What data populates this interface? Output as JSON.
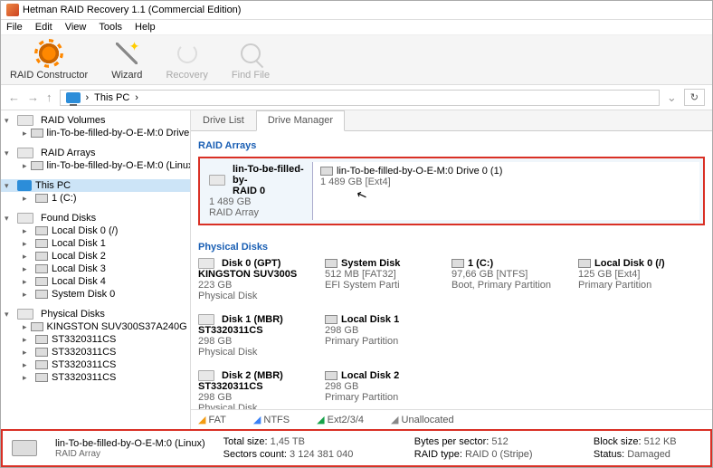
{
  "window": {
    "title": "Hetman RAID Recovery 1.1 (Commercial Edition)"
  },
  "menu": {
    "file": "File",
    "edit": "Edit",
    "view": "View",
    "tools": "Tools",
    "help": "Help"
  },
  "toolbar": {
    "raid_constructor": "RAID Constructor",
    "wizard": "Wizard",
    "recovery": "Recovery",
    "find_file": "Find File"
  },
  "nav": {
    "path": "This PC",
    "sep": "›"
  },
  "tree": {
    "raid_volumes": "RAID Volumes",
    "raid_vol_item": "lin-To-be-filled-by-O-E-M:0 Drive 0",
    "raid_arrays": "RAID Arrays",
    "raid_arr_item": "lin-To-be-filled-by-O-E-M:0 (Linux)",
    "this_pc": "This PC",
    "c_drive": "1 (C:)",
    "found_disks": "Found Disks",
    "local_disk_0": "Local Disk 0 (/)",
    "local_disk_1": "Local Disk 1",
    "local_disk_2": "Local Disk 2",
    "local_disk_3": "Local Disk 3",
    "local_disk_4": "Local Disk 4",
    "system_disk_0": "System Disk 0",
    "physical_disks": "Physical Disks",
    "kingston": "KINGSTON SUV300S37A240G",
    "st1": "ST3320311CS",
    "st2": "ST3320311CS",
    "st3": "ST3320311CS",
    "st4": "ST3320311CS"
  },
  "tabs": {
    "drive_list": "Drive List",
    "drive_manager": "Drive Manager"
  },
  "sections": {
    "raid_arrays": "RAID Arrays",
    "physical_disks": "Physical Disks"
  },
  "raid_box": {
    "left_name": "lin-To-be-filled-by-",
    "left_type": "RAID 0",
    "left_size": "1 489 GB",
    "left_kind": "RAID Array",
    "right_name": "lin-To-be-filled-by-O-E-M:0 Drive 0 (1)",
    "right_size": "1 489 GB [Ext4]"
  },
  "disks": [
    {
      "name": "Disk 0 (GPT)",
      "model": "KINGSTON SUV300S",
      "size": "223 GB",
      "kind": "Physical Disk",
      "parts": [
        {
          "name": "System Disk",
          "size": "512 MB [FAT32]",
          "role": "EFI System Parti"
        },
        {
          "name": "1 (C:)",
          "size": "97,66 GB [NTFS]",
          "role": "Boot, Primary Partition"
        },
        {
          "name": "Local Disk 0 (/)",
          "size": "125 GB [Ext4]",
          "role": "Primary Partition"
        }
      ]
    },
    {
      "name": "Disk 1 (MBR)",
      "model": "ST3320311CS",
      "size": "298 GB",
      "kind": "Physical Disk",
      "parts": [
        {
          "name": "Local Disk 1",
          "size": "298 GB",
          "role": "Primary Partition"
        }
      ]
    },
    {
      "name": "Disk 2 (MBR)",
      "model": "ST3320311CS",
      "size": "298 GB",
      "kind": "Physical Disk",
      "parts": [
        {
          "name": "Local Disk 2",
          "size": "298 GB",
          "role": "Primary Partition"
        }
      ]
    }
  ],
  "legend": {
    "fat": "FAT",
    "ntfs": "NTFS",
    "ext": "Ext2/3/4",
    "unalloc": "Unallocated"
  },
  "status": {
    "name": "lin-To-be-filled-by-O-E-M:0 (Linux)",
    "kind": "RAID Array",
    "total_size_l": "Total size:",
    "total_size_v": "1,45 TB",
    "bps_l": "Bytes per sector:",
    "bps_v": "512",
    "block_l": "Block size:",
    "block_v": "512 KB",
    "sectors_l": "Sectors count:",
    "sectors_v": "3 124 381 040",
    "type_l": "RAID type:",
    "type_v": "RAID 0 (Stripe)",
    "status_l": "Status:",
    "status_v": "Damaged"
  }
}
